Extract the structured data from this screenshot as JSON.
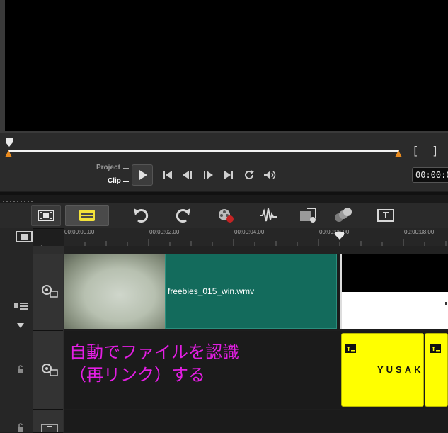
{
  "player": {
    "mode_project": "Project",
    "mode_clip": "Clip",
    "bracket_in": "[",
    "bracket_out": "]",
    "timecode": "00:00:0",
    "controls": [
      "start-icon",
      "prev-frame-icon",
      "next-frame-icon",
      "end-icon",
      "repeat-icon",
      "volume-icon"
    ]
  },
  "toolbar": {
    "buttons": [
      "storyboard-view-icon",
      "timeline-view-icon",
      "undo-icon",
      "redo-icon",
      "record-capture-icon",
      "audio-mixer-icon",
      "auto-music-icon",
      "motion-tracking-icon",
      "subtitle-editor-icon"
    ]
  },
  "timeline": {
    "zoom_control": "+/−",
    "ruler_labels": [
      "00:00:00.00",
      "00:00:02.00",
      "00:00:04.00",
      "00:00:06.00",
      "00:00:08.00"
    ],
    "video_clip_name": "freebies_015_win.wmv",
    "overlay_clip_title": "YUSAK"
  },
  "annotation": {
    "text": "自動でファイルを認識\n（再リンク）する",
    "color": "#e41ee4"
  },
  "colors": {
    "clip_green": "#136b5c",
    "title_yellow": "#ffff00",
    "trim_orange": "#e98a1d",
    "highlight_yellow": "#f3e23a"
  }
}
